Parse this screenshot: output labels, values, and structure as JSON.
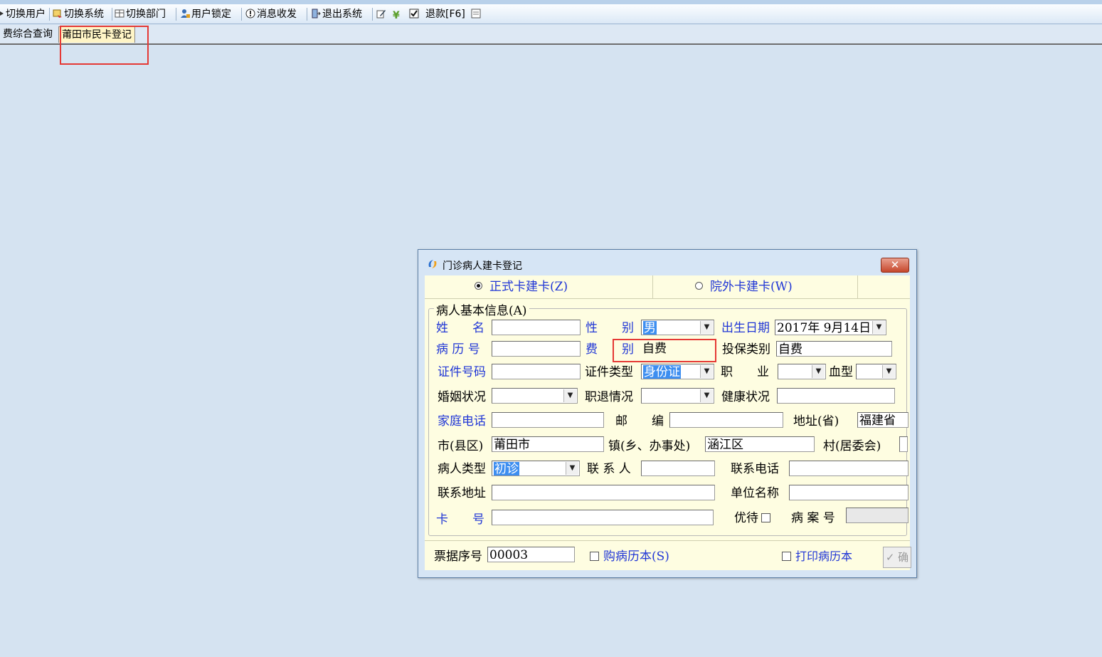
{
  "toolbar": {
    "switch_user": "切换用户",
    "switch_system": "切换系统",
    "switch_dept": "切换部门",
    "lock_user": "用户锁定",
    "messages": "消息收发",
    "exit_system": "退出系统",
    "refund": "退款[F6]"
  },
  "tabs": [
    "费综合查询",
    "莆田市民卡登记"
  ],
  "dialog": {
    "title": "门诊病人建卡登记",
    "close_glyph": "✕",
    "radio_formal": "正式卡建卡(Z)",
    "radio_external": "院外卡建卡(W)",
    "group_title": "病人基本信息(A)",
    "fields": {
      "name_label": "姓　　名",
      "gender_label": "性　　别",
      "gender_value": "男",
      "birth_label": "出生日期",
      "birth_value": "2017年  9月14日",
      "record_no_label": "病 历 号",
      "fee_label": "费　　别",
      "fee_value": "自费",
      "insure_label": "投保类别",
      "insure_value": "自费",
      "id_no_label": "证件号码",
      "id_type_label": "证件类型",
      "id_type_value": "身份证",
      "job_label": "职　　业",
      "blood_label": "血型",
      "marital_label": "婚姻状况",
      "retire_label": "职退情况",
      "health_label": "健康状况",
      "home_phone_label": "家庭电话",
      "postcode_label": "邮　　编",
      "province_label": "地址(省)",
      "province_value": "福建省",
      "city_label": "市(县区)",
      "city_value": "莆田市",
      "town_label": "镇(乡、办事处)",
      "town_value": "涵江区",
      "village_label": "村(居委会)",
      "patient_type_label": "病人类型",
      "patient_type_value": "初诊",
      "contact_label": "联 系 人",
      "contact_phone_label": "联系电话",
      "contact_addr_label": "联系地址",
      "unit_label": "单位名称",
      "card_label": "卡　　号",
      "priority_label": "优待",
      "case_no_label": "病 案 号"
    },
    "ticket_label": "票据序号",
    "ticket_value": "00003",
    "buy_record_label": "购病历本(S)",
    "print_record_label": "打印病历本",
    "confirm_label": "✓ 确"
  }
}
